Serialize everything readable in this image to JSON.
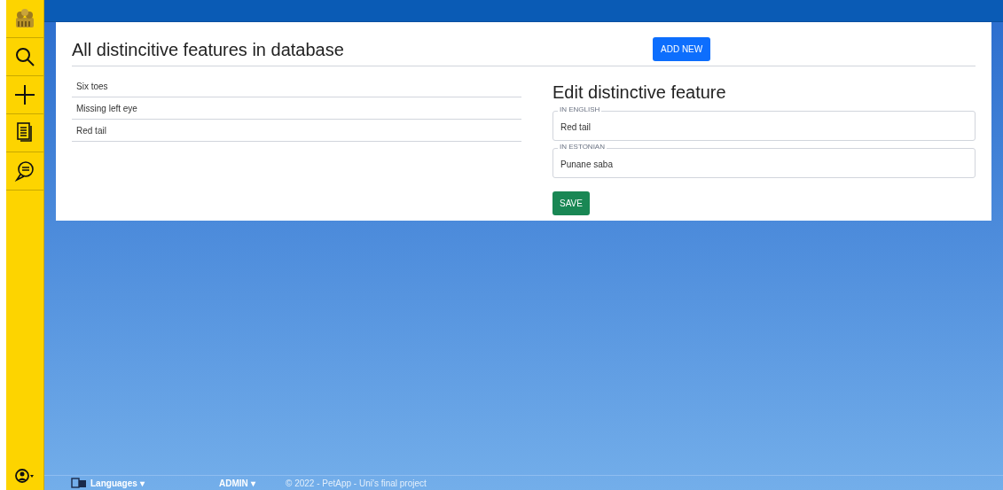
{
  "sidebar": {
    "items": [
      {
        "kind": "logo"
      },
      {
        "kind": "search"
      },
      {
        "kind": "add"
      },
      {
        "kind": "documents"
      },
      {
        "kind": "chat"
      }
    ]
  },
  "list_panel": {
    "title": "All distincitive features in database",
    "items": [
      "Six toes",
      "Missing left eye",
      "Red tail"
    ]
  },
  "add_button": "ADD NEW",
  "edit_panel": {
    "title": "Edit distinctive feature",
    "fields": [
      {
        "label": "IN ENGLISH",
        "value": "Red tail"
      },
      {
        "label": "IN ESTONIAN",
        "value": "Punane saba"
      }
    ],
    "save_button": "SAVE"
  },
  "footer": {
    "languages": "Languages ▾",
    "admin": "ADMIN ▾",
    "copyright": "© 2022 - PetApp - Uni's final project"
  }
}
